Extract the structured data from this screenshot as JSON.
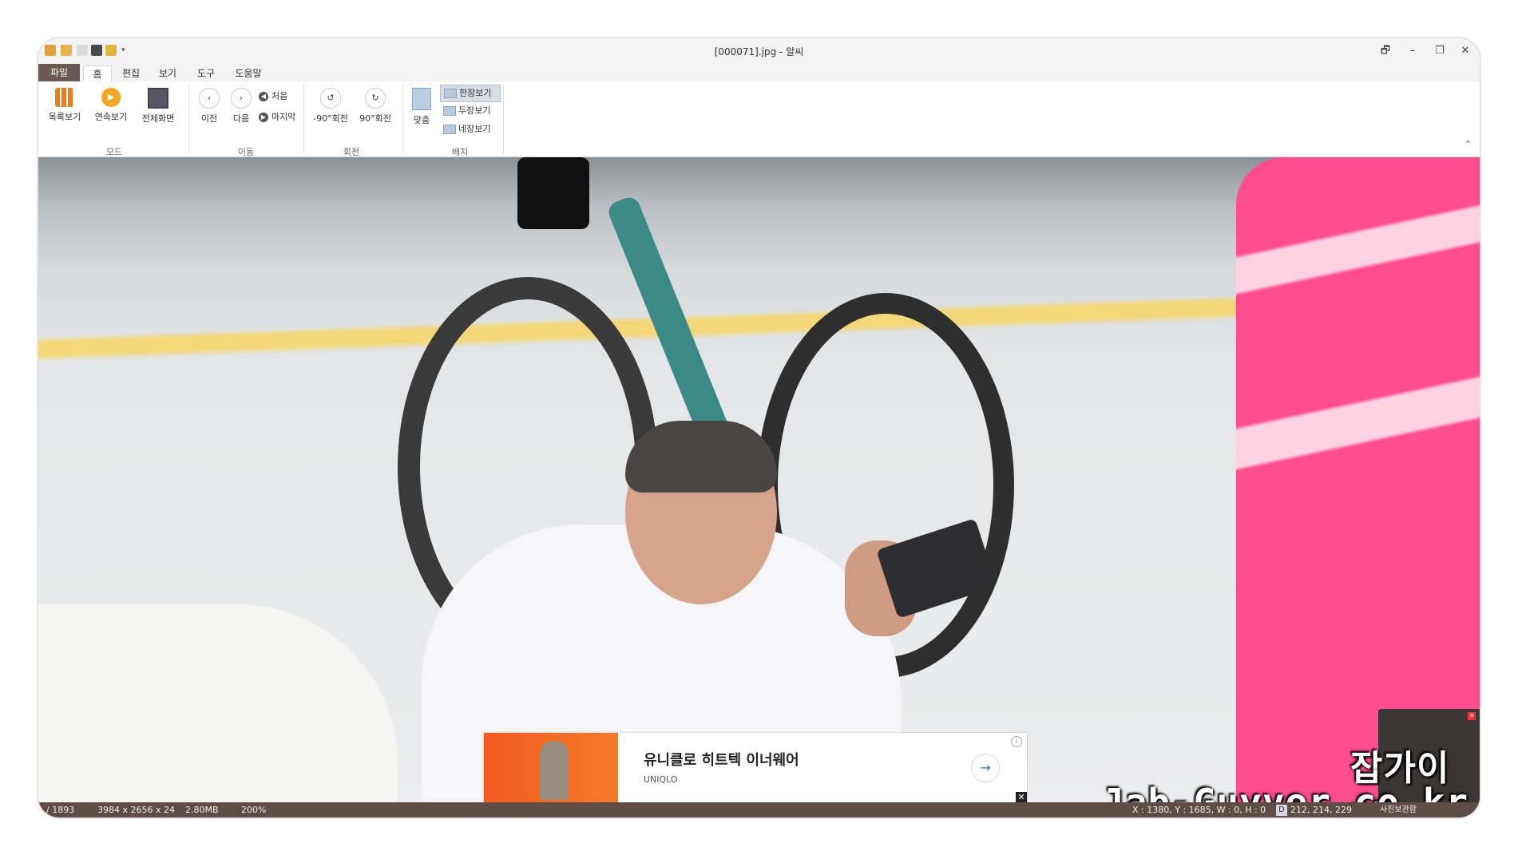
{
  "window": {
    "title": "[000071].jpg - 알씨",
    "controls": {
      "restore_down": "🗗",
      "minimize": "–",
      "maximize": "❐",
      "close": "✕"
    }
  },
  "tabs": [
    "파일",
    "홈",
    "편집",
    "보기",
    "도구",
    "도움말"
  ],
  "ribbon": {
    "mode_group": {
      "label": "모드",
      "buttons": [
        "목록보기",
        "연속보기",
        "전체화면"
      ]
    },
    "move_group": {
      "label": "이동",
      "prev": "이전",
      "next": "다음",
      "first": "처음",
      "last": "마지막"
    },
    "rotate_group": {
      "label": "회전",
      "ccw": "-90°회전",
      "cw": "90°회전"
    },
    "layout_group": {
      "label": "배치",
      "fit": "맞춤",
      "single": "한장보기",
      "double": "두장보기",
      "quad": "네장보기"
    },
    "collapse_glyph": "⌃"
  },
  "ad": {
    "title": "유니클로 히트텍 이너웨어",
    "brand": "UNIQLO",
    "arrow": "→",
    "info": "i",
    "close": "✕"
  },
  "watermark": {
    "korean": "잡가이버",
    "domain": "Jab-Guyver.co.kr"
  },
  "statusbar": {
    "index": "/ 1893",
    "dimensions": "3984 x 2656 x 24",
    "filesize": "2.80MB",
    "zoom": "200%",
    "cursor": "X : 1380, Y : 1685, W : 0, H : 0",
    "color_badge": "D",
    "color_value": "212, 214, 229",
    "album": "사진보관함"
  },
  "colors": {
    "accent_file_tab": "#6b5a52",
    "statusbar_bg": "#5d4d46",
    "play_button": "#f5a623"
  }
}
